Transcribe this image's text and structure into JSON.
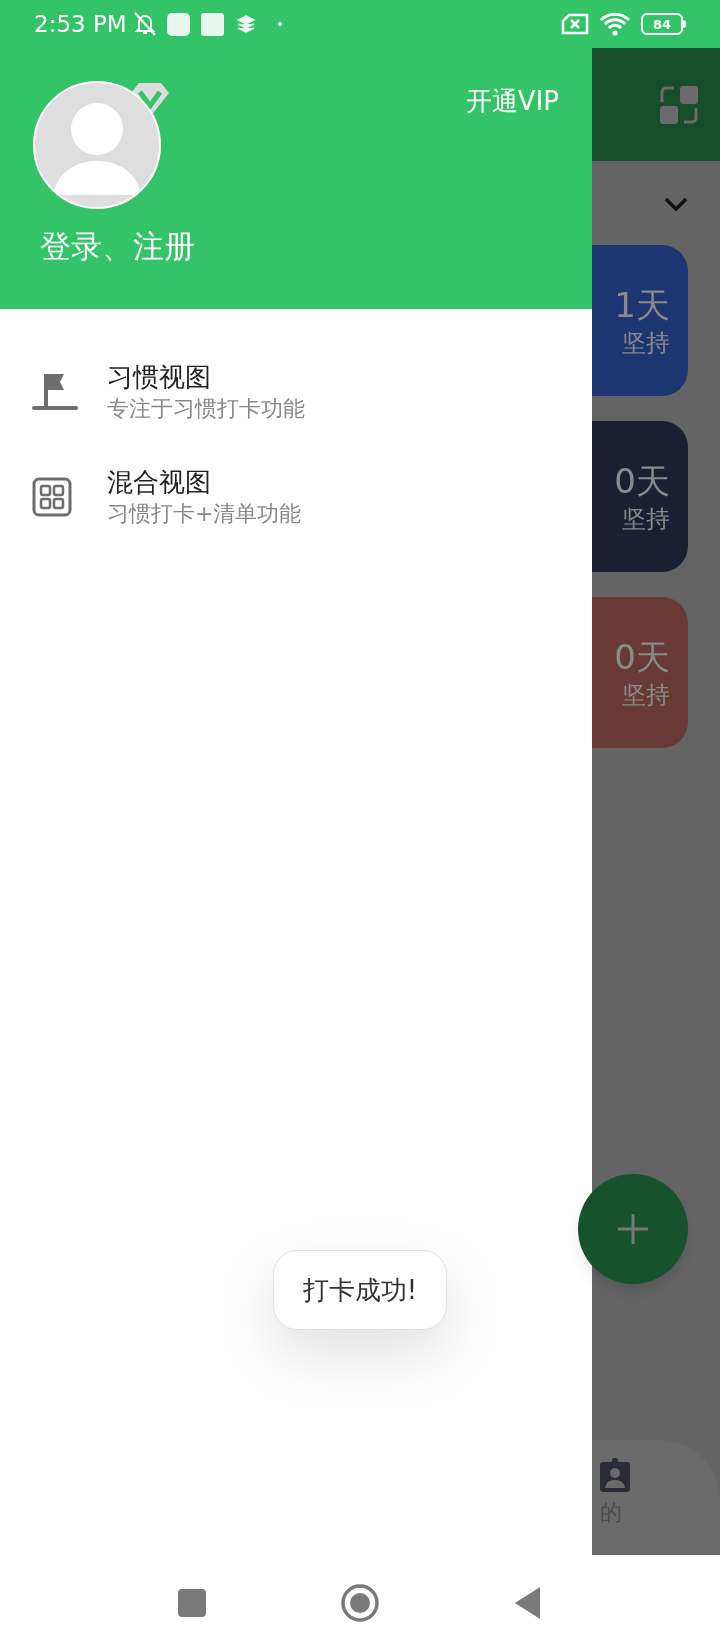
{
  "status_bar": {
    "time": "2:53 PM",
    "battery": "84"
  },
  "drawer": {
    "vip_link": "开通VIP",
    "login_text": "登录、注册",
    "menu": [
      {
        "kind": "flag",
        "title": "习惯视图",
        "subtitle": "专注于习惯打卡功能"
      },
      {
        "kind": "grid",
        "title": "混合视图",
        "subtitle": "习惯打卡+清单功能"
      }
    ]
  },
  "background_app": {
    "cards": [
      {
        "days": "1天",
        "label": "坚持",
        "color": "#1b3670"
      },
      {
        "days": "0天",
        "label": "坚持",
        "color": "#1a1f31"
      },
      {
        "days": "0天",
        "label": "坚持",
        "color": "#673a36"
      }
    ],
    "bottom_nav": {
      "label": "的"
    }
  },
  "toast": {
    "text": "打卡成功!"
  }
}
